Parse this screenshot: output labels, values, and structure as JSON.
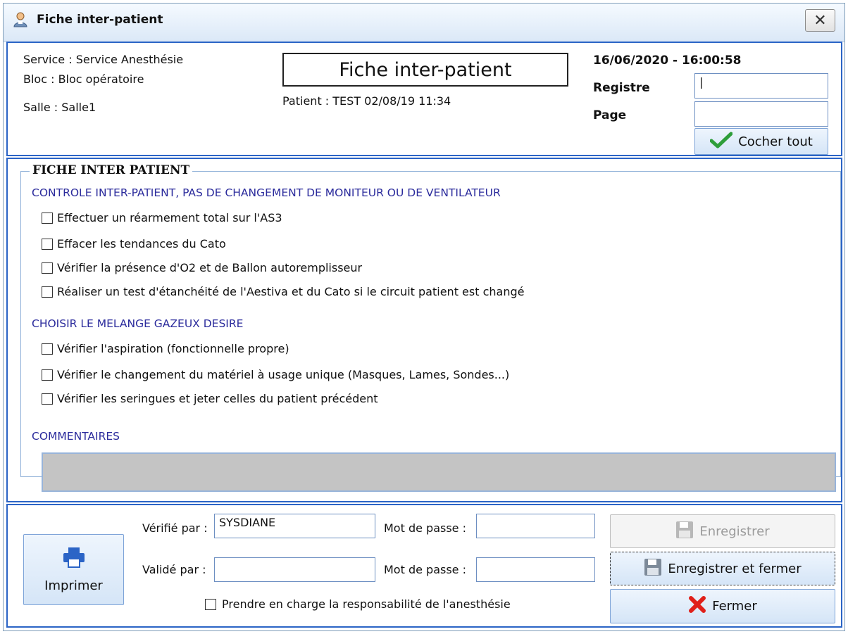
{
  "window": {
    "title": "Fiche inter-patient",
    "close_glyph": "✕",
    "icon": "app-person-icon"
  },
  "header": {
    "service": "Service : Service Anesthésie",
    "bloc": "Bloc : Bloc opératoire",
    "salle": "Salle : Salle1",
    "form_title": "Fiche inter-patient",
    "patient": "Patient : TEST 02/08/19 11:34",
    "datetime": "16/06/2020 - 16:00:58",
    "registre_label": "Registre",
    "registre_value": "|",
    "page_label": "Page",
    "page_value": "",
    "check_all_label": "Cocher tout"
  },
  "group": {
    "title": "FICHE INTER PATIENT",
    "section1_title": "CONTROLE INTER-PATIENT, PAS DE CHANGEMENT DE MONITEUR OU DE VENTILATEUR",
    "section1_items": [
      {
        "label": "Effectuer un réarmement total sur l'AS3",
        "checked": false
      },
      {
        "label": "Effacer les tendances du Cato",
        "checked": false
      },
      {
        "label": "Vérifier la présence d'O2 et de Ballon autoremplisseur",
        "checked": false
      },
      {
        "label": "Réaliser un test d'étanchéité de l'Aestiva et du Cato si le circuit patient est changé",
        "checked": false
      }
    ],
    "section2_title": "CHOISIR LE MELANGE GAZEUX DESIRE",
    "section2_items": [
      {
        "label": "Vérifier l'aspiration (fonctionnelle propre)",
        "checked": false
      },
      {
        "label": "Vérifier le changement du matériel à usage unique (Masques, Lames, Sondes...)",
        "checked": false
      },
      {
        "label": "Vérifier les seringues et jeter celles du patient précédent",
        "checked": false
      }
    ],
    "comments_title": "COMMENTAIRES",
    "comments_value": ""
  },
  "footer": {
    "print_label": "Imprimer",
    "verified_by_label": "Vérifié par :",
    "verified_by_value": "SYSDIANE",
    "validated_by_label": "Validé par :",
    "validated_by_value": "",
    "password_label": "Mot de passe :",
    "password1_value": "",
    "password2_value": "",
    "responsibility_label": "Prendre en charge la responsabilité de l'anesthésie",
    "save_label": "Enregistrer",
    "save_close_label": "Enregistrer et fermer",
    "close_label": "Fermer"
  },
  "colors": {
    "accent_border": "#2b64c6",
    "section_text": "#2b2b9c",
    "check_green": "#2e9e3a",
    "close_red": "#e0201a"
  }
}
